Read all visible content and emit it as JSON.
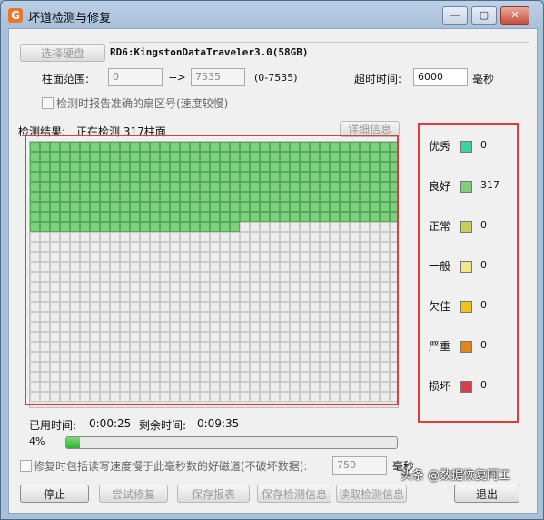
{
  "window": {
    "title": "坏道检测与修复",
    "app_icon": "G",
    "minimize": "—",
    "maximize": "▢",
    "close": "✕"
  },
  "disk": {
    "select_button": "选择硬盘",
    "name": "RD6:KingstonDataTraveler3.0(58GB)"
  },
  "range": {
    "label": "柱面范围:",
    "from": "0",
    "arrow": "-->",
    "to": "7535",
    "hint": "(0-7535)"
  },
  "timeout": {
    "label": "超时时间:",
    "value": "6000",
    "unit": "毫秒"
  },
  "report_sector_option": "检测时报告准确的扇区号(速度较慢)",
  "result": {
    "label": "检测结果:",
    "status": "正在检测 317柱面",
    "details_button": "详细信息"
  },
  "grid": {
    "columns": 37,
    "rows": 26,
    "tested": 317,
    "good_color": "#7ed07e",
    "good_border": "#54a954",
    "pending_color": "#ededed",
    "pending_border": "#c9c9c9"
  },
  "legend": [
    {
      "label": "优秀",
      "color": "#39d39b",
      "count": "0"
    },
    {
      "label": "良好",
      "color": "#7ed07e",
      "count": "317"
    },
    {
      "label": "正常",
      "color": "#c9cf5a",
      "count": "0"
    },
    {
      "label": "一般",
      "color": "#f2e58a",
      "count": "0"
    },
    {
      "label": "欠佳",
      "color": "#f3c21a",
      "count": "0"
    },
    {
      "label": "严重",
      "color": "#e4841e",
      "count": "0"
    },
    {
      "label": "损坏",
      "color": "#d2404a",
      "count": "0"
    }
  ],
  "time": {
    "used_label": "已用时间:",
    "used": "0:00:25",
    "remaining_label": "剩余时间:",
    "remaining": "0:09:35"
  },
  "progress": {
    "text": "4%",
    "value": 0.04
  },
  "repair_option": {
    "label": "修复时包括读写速度慢于此毫秒数的好磁道(不破坏数据):",
    "value": "750",
    "unit": "毫秒"
  },
  "buttons": {
    "stop": "停止",
    "try_repair": "尝试修复",
    "save_report": "保存报表",
    "save_info": "保存检测信息",
    "load_info": "读取检测信息",
    "exit": "退出"
  },
  "watermark": "头条 @数据恢复阿工"
}
